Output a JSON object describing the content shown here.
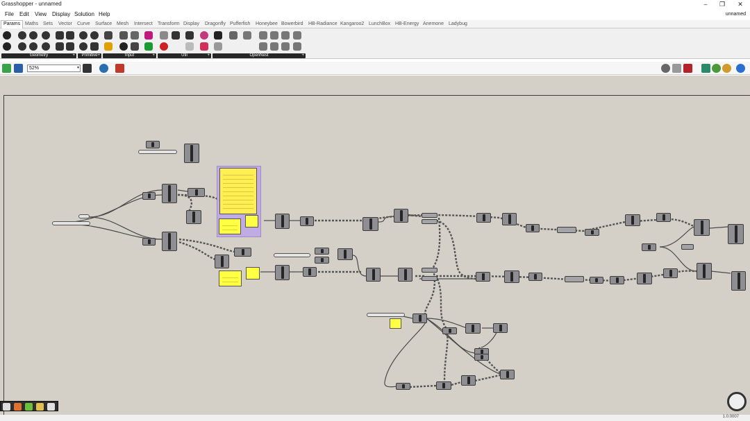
{
  "window": {
    "title": "Grasshopper - unnamed",
    "minimize": "–",
    "maximize": "❐",
    "close": "✕"
  },
  "menu": {
    "items": [
      "File",
      "Edit",
      "View",
      "Display",
      "Solution",
      "Help"
    ],
    "document_name": "unnamed"
  },
  "tabs": [
    "Params",
    "Maths",
    "Sets",
    "Vector",
    "Curve",
    "Surface",
    "Mesh",
    "Intersect",
    "Transform",
    "Display",
    "Dragonfly",
    "Pufferfish",
    "Honeybee",
    "Bowerbird",
    "HB-Radiance",
    "Kangaroo2",
    "LunchBox",
    "HB-Energy",
    "Anemone",
    "Ladybug"
  ],
  "active_tab": "Params",
  "ribbon_groups": [
    {
      "label": "Geometry",
      "expand": "+"
    },
    {
      "label": "Primitive",
      "expand": "+"
    },
    {
      "label": "Input",
      "expand": "+"
    },
    {
      "label": "Util",
      "expand": "+"
    },
    {
      "label": "OpenNest",
      "expand": "+"
    }
  ],
  "toolbar": {
    "zoom_value": "52%",
    "zoom_dropdown": "▾",
    "left_icons": [
      "open-file-icon",
      "save-file-icon",
      "zoom-extents-icon",
      "preview-eye-icon",
      "sketch-pen-icon"
    ],
    "right_icons": [
      "preview-off-icon",
      "wireframe-preview-icon",
      "shaded-preview-icon",
      "bake-icon",
      "green-sphere-icon",
      "yellow-sphere-icon",
      "blue-sphere-icon"
    ]
  },
  "bottom_tools": [
    "download-icon",
    "timer-icon",
    "chart-icon",
    "lasso-icon",
    "sort-icon"
  ],
  "status": {
    "version": "1.0.0007"
  },
  "colors": {
    "canvas": "#d4d0c8",
    "component": "#8f8f93",
    "panel": "#ffff44",
    "group": "#bfa8e6",
    "wire": "#4a4a4a"
  }
}
